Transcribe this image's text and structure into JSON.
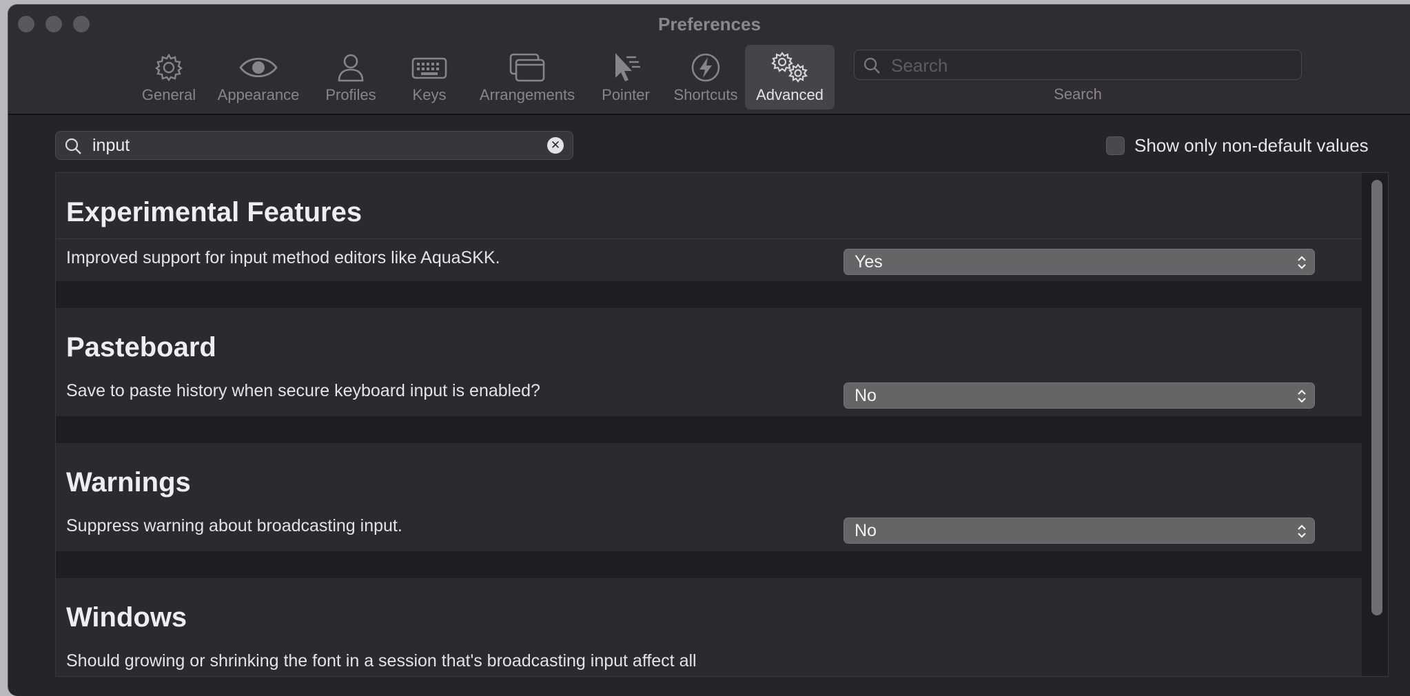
{
  "window": {
    "title": "Preferences"
  },
  "toolbar": {
    "items": [
      {
        "label": "General",
        "icon": "gear-icon"
      },
      {
        "label": "Appearance",
        "icon": "eye-icon"
      },
      {
        "label": "Profiles",
        "icon": "person-icon"
      },
      {
        "label": "Keys",
        "icon": "keyboard-icon"
      },
      {
        "label": "Arrangements",
        "icon": "windows-icon"
      },
      {
        "label": "Pointer",
        "icon": "pointer-icon"
      },
      {
        "label": "Shortcuts",
        "icon": "bolt-icon"
      },
      {
        "label": "Advanced",
        "icon": "gears-icon"
      }
    ],
    "active": "Advanced",
    "search": {
      "placeholder": "Search",
      "label": "Search"
    }
  },
  "filter": {
    "value": "input"
  },
  "show_non_default": {
    "label": "Show only non-default values",
    "checked": false
  },
  "sections": [
    {
      "heading": "Experimental Features",
      "description": "Improved support for input method editors like AquaSKK.",
      "value": "Yes"
    },
    {
      "heading": "Pasteboard",
      "description": "Save to paste history when secure keyboard input is enabled?",
      "value": "No"
    },
    {
      "heading": "Warnings",
      "description": "Suppress warning about broadcasting input.",
      "value": "No"
    },
    {
      "heading": "Windows",
      "description": "Should growing or shrinking the font in a session that's broadcasting input affect all"
    }
  ],
  "colors": {
    "background": "#262329",
    "titlebar": "#2f2c33",
    "popup": "#656467"
  }
}
